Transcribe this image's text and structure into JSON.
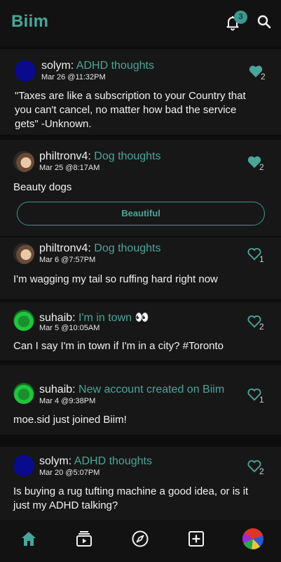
{
  "app": {
    "title": "Biim"
  },
  "header": {
    "notification_count": "3"
  },
  "posts": [
    {
      "user": "solym:",
      "topic": "ADHD thoughts",
      "date": "Mar 26 @11:32PM",
      "text": "\"Taxes are like a subscription to your Country that you can't cancel, no matter how bad the service gets\" -Unknown.",
      "likes": "2",
      "liked": true
    },
    {
      "user": "philtronv4:",
      "topic": "Dog thoughts",
      "date": "Mar 25 @8:17AM",
      "text": "Beauty dogs",
      "likes": "2",
      "liked": true,
      "reply_label": "Beautiful"
    },
    {
      "user": "philtronv4:",
      "topic": "Dog thoughts",
      "date": "Mar 6 @7:57PM",
      "text": "I'm wagging my tail so ruffing hard right now",
      "likes": "1",
      "liked": false
    },
    {
      "user": "suhaib:",
      "topic": "I'm in town 👀",
      "date": "Mar 5 @10:05AM",
      "text": "Can I say I'm in town if I'm in a city? #Toronto",
      "likes": "2",
      "liked": false
    },
    {
      "user": "suhaib:",
      "topic": "New account created on Biim",
      "date": "Mar 4 @9:38PM",
      "text": "moe.sid just joined Biim!",
      "likes": "1",
      "liked": false
    },
    {
      "user": "solym:",
      "topic": "ADHD thoughts",
      "date": "Mar 20 @5:07PM",
      "text": "Is buying a rug tufting machine a good idea, or is it just my ADHD talking?",
      "likes": "2",
      "liked": false
    }
  ],
  "icons": {
    "header": [
      "bell-icon",
      "search-icon"
    ],
    "tabs": [
      "home-icon",
      "library-icon",
      "compass-icon",
      "plus-square-icon",
      "profile-avatar"
    ]
  },
  "colors": {
    "accent": "#4aa59a",
    "background": "#0d0d0d",
    "card": "#171717"
  }
}
